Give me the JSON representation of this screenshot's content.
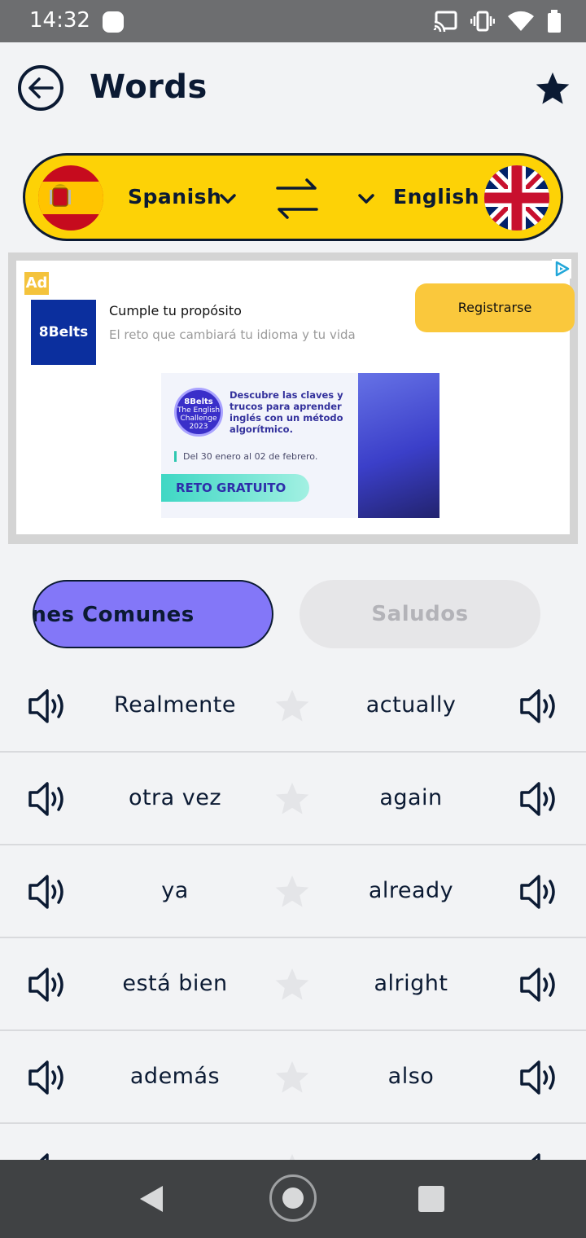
{
  "status_bar": {
    "time": "14:32"
  },
  "header": {
    "title": "Words"
  },
  "languages": {
    "from": "Spanish",
    "to": "English"
  },
  "ad": {
    "tag": "Ad",
    "brand": "8Belts",
    "headline": "Cumple tu propósito",
    "subtext": "El reto que cambiará tu idioma y tu vida",
    "cta": "Registrarse",
    "banner": {
      "badge_line1": "8Belts",
      "badge_line2": "The English",
      "badge_line3": "Challenge",
      "badge_line4": "2023",
      "copy": "Descubre las claves y trucos para aprender inglés con un método algorítmico.",
      "dates": "Del 30 enero al 02 de febrero.",
      "button": "RETO GRATUITO"
    }
  },
  "tabs": [
    {
      "label": "ones Comunes",
      "active": true
    },
    {
      "label": "Saludos",
      "active": false
    }
  ],
  "words": [
    {
      "es": "Realmente",
      "en": "actually"
    },
    {
      "es": "otra vez",
      "en": "again"
    },
    {
      "es": "ya",
      "en": "already"
    },
    {
      "es": "está bien",
      "en": "alright"
    },
    {
      "es": "además",
      "en": "also"
    }
  ],
  "colors": {
    "accent_yellow": "#fdd206",
    "tab_active": "#8377f8",
    "ink": "#0b1a33"
  }
}
